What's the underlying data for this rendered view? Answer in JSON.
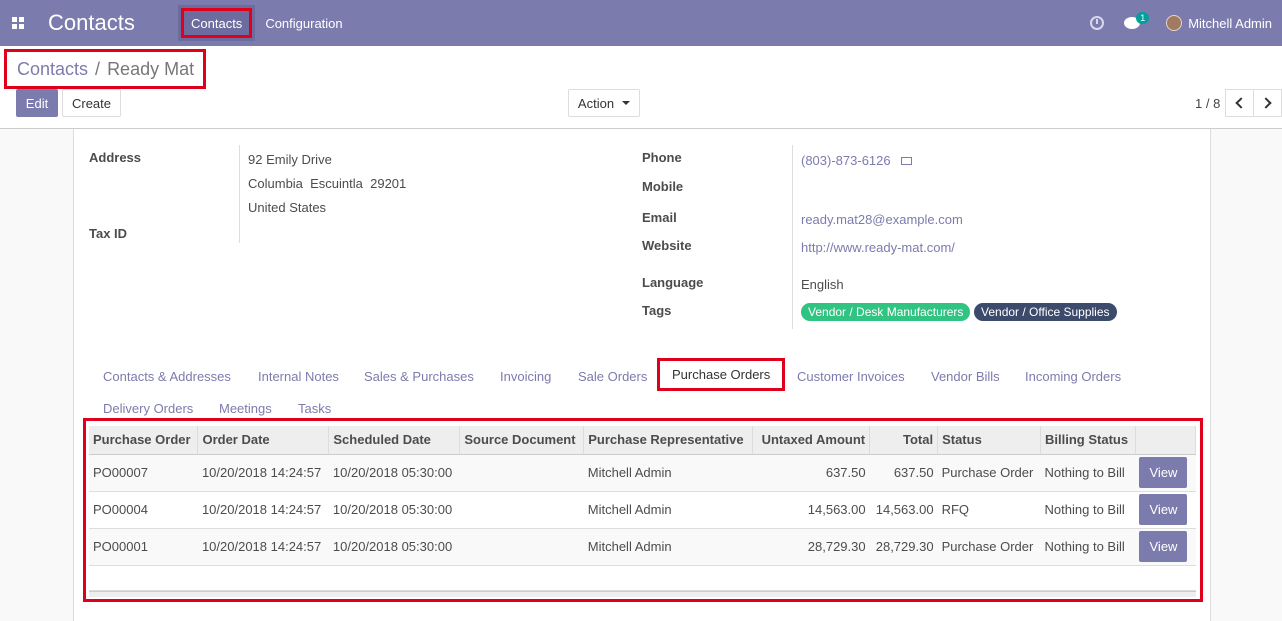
{
  "topbar": {
    "app_title": "Contacts",
    "menu": [
      "Contacts",
      "Configuration"
    ],
    "chat_count": "1",
    "user_name": "Mitchell Admin"
  },
  "breadcrumb": {
    "parent": "Contacts",
    "separator": "/",
    "current": "Ready Mat"
  },
  "buttons": {
    "edit": "Edit",
    "create": "Create",
    "action": "Action"
  },
  "pager": {
    "value": "1 / 8"
  },
  "form": {
    "address_label": "Address",
    "address_lines": [
      "92 Emily Drive",
      "Columbia  Escuintla  29201",
      "United States"
    ],
    "tax_id_label": "Tax ID",
    "phone_label": "Phone",
    "phone_value": "(803)-873-6126",
    "mobile_label": "Mobile",
    "email_label": "Email",
    "email_value": "ready.mat28@example.com",
    "website_label": "Website",
    "website_value": "http://www.ready-mat.com/",
    "language_label": "Language",
    "language_value": "English",
    "tags_label": "Tags",
    "tags": [
      "Vendor / Desk Manufacturers",
      "Vendor / Office Supplies"
    ]
  },
  "tabs": [
    "Contacts & Addresses",
    "Internal Notes",
    "Sales & Purchases",
    "Invoicing",
    "Sale Orders",
    "Purchase Orders",
    "Customer Invoices",
    "Vendor Bills",
    "Incoming Orders",
    "Delivery Orders",
    "Meetings",
    "Tasks"
  ],
  "table": {
    "headers": [
      "Purchase Order",
      "Order Date",
      "Scheduled Date",
      "Source Document",
      "Purchase Representative",
      "Untaxed Amount",
      "Total",
      "Status",
      "Billing Status"
    ],
    "rows": [
      [
        "PO00007",
        "10/20/2018 14:24:57",
        "10/20/2018 05:30:00",
        "",
        "Mitchell Admin",
        "637.50",
        "637.50",
        "Purchase Order",
        "Nothing to Bill"
      ],
      [
        "PO00004",
        "10/20/2018 14:24:57",
        "10/20/2018 05:30:00",
        "",
        "Mitchell Admin",
        "14,563.00",
        "14,563.00",
        "RFQ",
        "Nothing to Bill"
      ],
      [
        "PO00001",
        "10/20/2018 14:24:57",
        "10/20/2018 05:30:00",
        "",
        "Mitchell Admin",
        "28,729.30",
        "28,729.30",
        "Purchase Order",
        "Nothing to Bill"
      ]
    ],
    "view_label": "View"
  }
}
